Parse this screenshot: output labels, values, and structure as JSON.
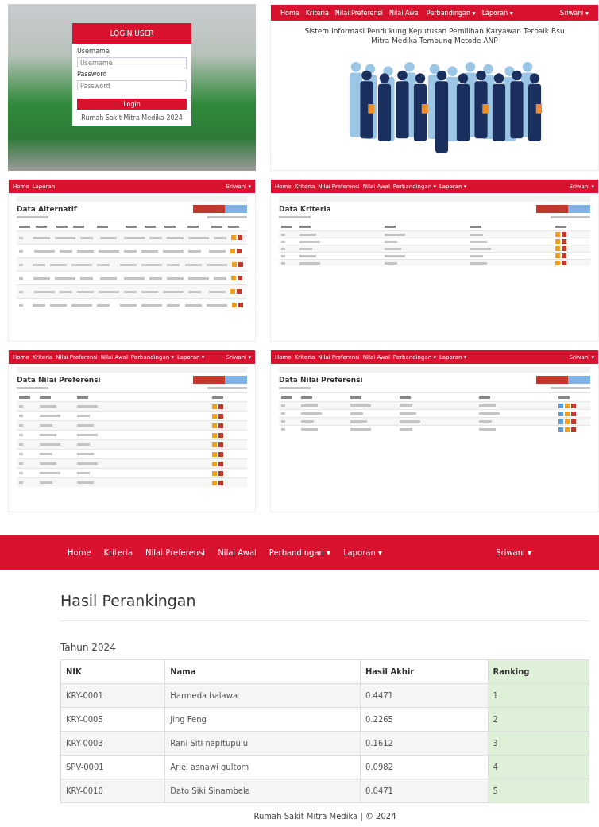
{
  "login": {
    "title": "LOGIN USER",
    "fields": [
      {
        "label": "Username",
        "placeholder": "Username"
      },
      {
        "label": "Password",
        "placeholder": "Password"
      }
    ],
    "button": "Login",
    "footer": "Rumah Sakit Mitra Medika 2024"
  },
  "home": {
    "nav": [
      "Home",
      "Kriteria",
      "Nilai Preferensi",
      "Nilai Awal",
      "Perbandingan ▾",
      "Laporan ▾"
    ],
    "user": "Sriwani ▾",
    "heading": "Sistem Informasi Pendukung Keputusan Pemilihan Karyawan Terbaik Rsu Mitra Medika Tembung Metode ANP"
  },
  "lists": [
    {
      "nav": [
        "Home",
        "Laporan"
      ],
      "user": "Sriwani ▾",
      "title": "Data Alternatif",
      "kind": "alternatif"
    },
    {
      "nav": [
        "Home",
        "Kriteria",
        "Nilai Preferensi",
        "Nilai Awal",
        "Perbandingan ▾",
        "Laporan ▾"
      ],
      "user": "Sriwani ▾",
      "title": "Data Kriteria",
      "kind": "kriteria"
    },
    {
      "nav": [
        "Home",
        "Kriteria",
        "Nilai Preferensi",
        "Nilai Awal",
        "Perbandingan ▾",
        "Laporan ▾"
      ],
      "user": "Sriwani ▾",
      "title": "Data Nilai Preferensi",
      "kind": "preferensi"
    },
    {
      "nav": [
        "Home",
        "Kriteria",
        "Nilai Preferensi",
        "Nilai Awal",
        "Perbandingan ▾",
        "Laporan ▾"
      ],
      "user": "Sriwani ▾",
      "title": "Data Nilai Preferensi",
      "kind": "nilai"
    }
  ],
  "result": {
    "nav": [
      "Home",
      "Kriteria",
      "Nilai Preferensi",
      "Nilai Awal",
      "Perbandingan ▾",
      "Laporan ▾"
    ],
    "user": "Sriwani ▾",
    "title": "Hasil Perankingan",
    "year": "Tahun 2024",
    "columns": [
      "NIK",
      "Nama",
      "Hasil Akhir",
      "Ranking"
    ],
    "rows": [
      [
        "KRY-0001",
        "Harmeda halawa",
        "0.4471",
        "1"
      ],
      [
        "KRY-0005",
        "Jing Feng",
        "0.2265",
        "2"
      ],
      [
        "KRY-0003",
        "Rani Siti napitupulu",
        "0.1612",
        "3"
      ],
      [
        "SPV-0001",
        "Ariel asnawi gultom",
        "0.0982",
        "4"
      ],
      [
        "KRY-0010",
        "Dato Siki Sinambela",
        "0.0471",
        "5"
      ]
    ],
    "footer": "Rumah Sakit Mitra Medika | © 2024"
  }
}
